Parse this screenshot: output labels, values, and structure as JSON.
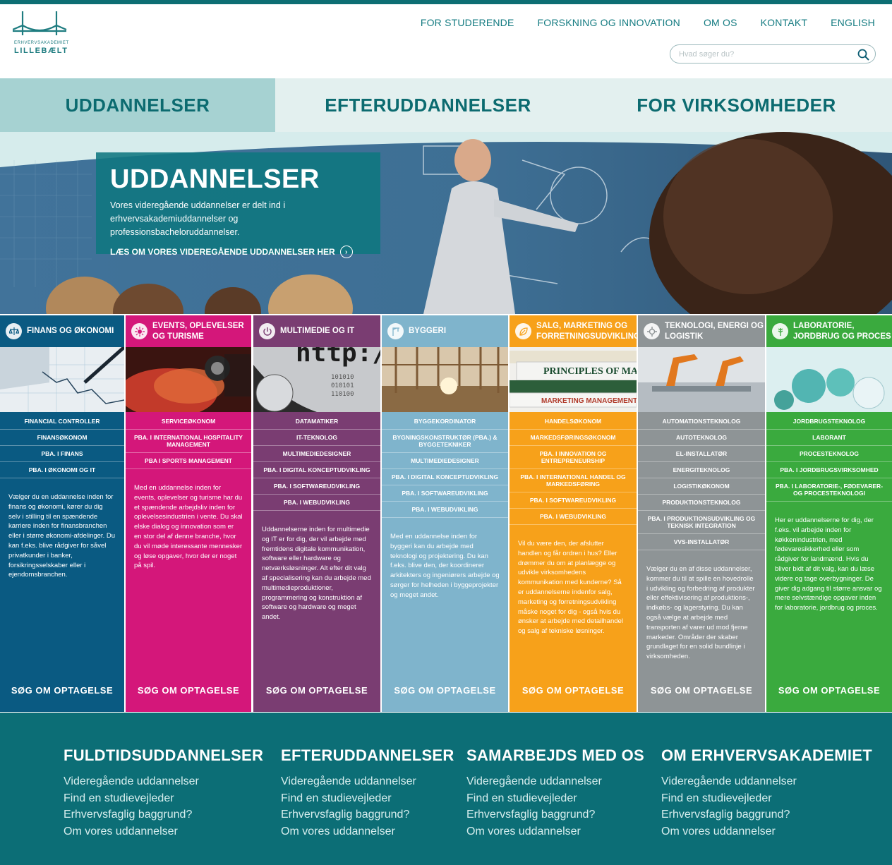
{
  "header": {
    "logo_small": "ERHVERVSAKADEMIET",
    "logo_big": "LILLEBÆLT",
    "nav": [
      "FOR STUDERENDE",
      "FORSKNING OG INNOVATION",
      "OM OS",
      "KONTAKT",
      "ENGLISH"
    ],
    "search_placeholder": "Hvad søger du?"
  },
  "tabs": [
    "UDDANNELSER",
    "EFTERUDDANNELSER",
    "FOR VIRKSOMHEDER"
  ],
  "hero": {
    "title": "UDDANNELSER",
    "text": "Vores videregående uddannelser er delt ind i erhvervsakademiuddannelser og professionsbacheloruddannelser.",
    "link": "LÆS OM VORES VIDEREGÅENDE UDDANNELSER HER"
  },
  "columns": [
    {
      "title": "FINANS OG ØKONOMI",
      "color": "#0a5a82",
      "items": [
        "FINANCIAL CONTROLLER",
        "FINANSØKONOM",
        "PBA. I FINANS",
        "PBA. I ØKONOMI OG IT"
      ],
      "desc": "Vælger du en uddannelse inden for finans og økonomi, kører du dig selv i stilling til en spændende karriere inden for finansbranchen eller i større økonomi-afdelinger. Du kan f.eks. blive rådgiver for såvel privatkunder i banker, forsikringsselskaber eller i ejendomsbranchen.",
      "cta": "SØG OM OPTAGELSE"
    },
    {
      "title": "EVENTS, OPLEVELSER OG TURISME",
      "color": "#d4177a",
      "items": [
        "SERVICEØKONOM",
        "PBA. I INTERNATIONAL HOSPITALITY MANAGEMENT",
        "PBA I SPORTS MANAGEMENT"
      ],
      "desc": "Med en uddannelse inden for events, oplevelser og turisme har du et spændende arbejdsliv inden for oplevelsesindustrien i vente. Du skal elske dialog og innovation som er en stor del af denne branche, hvor du vil møde interessante mennesker og løse opgaver, hvor der er noget på spil.",
      "cta": "SØG OM OPTAGELSE"
    },
    {
      "title": "MULTIMEDIE OG IT",
      "color": "#7a3d72",
      "items": [
        "DATAMATIKER",
        "IT-TEKNOLOG",
        "MULTIMEDIEDESIGNER",
        "PBA. I DIGITAL KONCEPTUDVIKLING",
        "PBA. I SOFTWAREUDVIKLING",
        "PBA. I WEBUDVIKLING"
      ],
      "desc": "Uddannelserne inden for multimedie og IT er for dig, der vil arbejde med fremtidens digitale kommunikation, software eller hardware og netværksløsninger. Alt efter dit valg af specialisering kan du arbejde med multimedieproduktioner, programmering og konstruktion af software og hardware og meget andet.",
      "cta": "SØG OM OPTAGELSE"
    },
    {
      "title": "BYGGERI",
      "color": "#7fb4cc",
      "items": [
        "BYGGEKORDINATOR",
        "BYGNINGSKONSTRUKTØR (PBA.) & BYGGETEKNIKER",
        "MULTIMEDIEDESIGNER",
        "PBA. I DIGITAL KONCEPTUDVIKLING",
        "PBA. I SOFTWAREUDVIKLING",
        "PBA. I WEBUDVIKLING"
      ],
      "desc": "Med en uddannelse inden for byggeri kan du arbejde med teknologi og projektering. Du kan f.eks. blive den, der koordinerer arkitekters og ingeniørers arbejde og sørger for helheden i byggeprojekter og meget andet.",
      "cta": "SØG OM OPTAGELSE"
    },
    {
      "title": "SALG, MARKETING OG FORRETNINGSUDVIKLING",
      "color": "#f7a11a",
      "items": [
        "HANDELSØKONOM",
        "MARKEDSFØRINGSØKONOM",
        "PBA. I INNOVATION OG ENTREPRENEURSHIP",
        "PBA. I INTERNATIONAL HANDEL OG MARKEDSFØRING",
        "PBA. I SOFTWAREUDVIKLING",
        "PBA. I WEBUDVIKLING"
      ],
      "desc": "Vil du være den, der afslutter handlen og får ordren i hus? Eller drømmer du om at planlægge og udvikle virksomhedens kommunikation med kunderne? Så er uddannelserne indenfor salg, marketing og forretningsudvikling måske noget for dig - også hvis du ønsker at arbejde med detailhandel og salg af tekniske løsninger.",
      "cta": "SØG OM OPTAGELSE"
    },
    {
      "title": "TEKNOLOGI, ENERGI OG LOGISTIK",
      "color": "#8e9496",
      "items": [
        "AUTOMATIONSTEKNOLOG",
        "AUTOTEKNOLOG",
        "EL-INSTALLATØR",
        "ENERGITEKNOLOG",
        "LOGISTIKØKONOM",
        "PRODUKTIONSTEKNOLOG",
        "PBA. I PRODUKTIONSUDVIKLING OG TEKNISK INTEGRATION",
        "VVS-INSTALLATØR"
      ],
      "desc": "Vælger du en af disse uddannelser, kommer du til at spille en hovedrolle i udvikling og forbedring af produkter eller effektivisering af produktions-, indkøbs- og lagerstyring. Du kan også vælge at arbejde med transporten af varer ud mod fjerne markeder. Områder der skaber grundlaget for en solid bundlinje i virksomheden.",
      "cta": "SØG OM OPTAGELSE"
    },
    {
      "title": "LABORATORIE, JORDBRUG OG PROCES",
      "color": "#3aaa3e",
      "items": [
        "JORDBRUGSTEKNOLOG",
        "LABORANT",
        "PROCESTEKNOLOG",
        "PBA. I JORDBRUGSVIRKSOMHED",
        "PBA. I LABORATORIE-, FØDEVARER- OG PROCESTEKNOLOGI"
      ],
      "desc": "Her er uddannelserne for dig, der f.eks. vil arbejde inden for køkkenindustrien, med fødevaresikkerhed eller som rådgiver for landmænd. Hvis du bliver bidt af dit valg, kan du læse videre og tage overbygninger. De giver dig adgang til større ansvar og mere selvstændige opgaver inden for laboratorie, jordbrug og proces.",
      "cta": "SØG OM OPTAGELSE"
    }
  ],
  "footer": [
    {
      "title": "FULDTIDSUDDANNELSER",
      "links": [
        "Videregående uddannelser",
        "Find en studievejleder",
        "Erhvervsfaglig baggrund?",
        "Om vores uddannelser"
      ]
    },
    {
      "title": "EFTERUDDANNELSER",
      "links": [
        "Videregående uddannelser",
        "Find en studievejleder",
        "Erhvervsfaglig baggrund?",
        "Om vores uddannelser"
      ]
    },
    {
      "title": "SAMARBEJDS MED OS",
      "links": [
        "Videregående uddannelser",
        "Find en studievejleder",
        "Erhvervsfaglig baggrund?",
        "Om vores uddannelser"
      ]
    },
    {
      "title": "OM ERHVERVSAKADEMIET",
      "links": [
        "Videregående uddannelser",
        "Find en studievejleder",
        "Erhvervsfaglig baggrund?",
        "Om vores uddannelser"
      ]
    }
  ]
}
